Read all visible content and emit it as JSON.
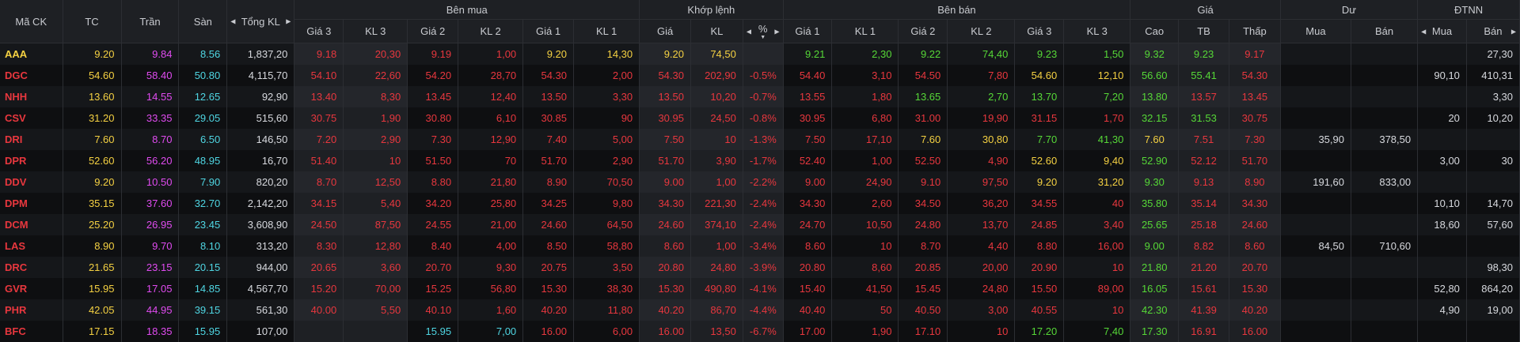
{
  "headers": {
    "symbol": "Mã CK",
    "ref": "TC",
    "ceiling": "Trần",
    "floor": "Sàn",
    "total_vol": "Tổng KL",
    "groups": {
      "buy": "Bên mua",
      "match": "Khớp lệnh",
      "sell": "Bên bán",
      "price": "Giá",
      "residual": "Dư",
      "foreign": "ĐTNN"
    },
    "buy": [
      "Giá 3",
      "KL 3",
      "Giá 2",
      "KL 2",
      "Giá 1",
      "KL 1"
    ],
    "match": [
      "Giá",
      "KL",
      "%"
    ],
    "sell": [
      "Giá 1",
      "KL 1",
      "Giá 2",
      "KL 2",
      "Giá 3",
      "KL 3"
    ],
    "price": [
      "Cao",
      "TB",
      "Thấp"
    ],
    "residual": [
      "Mua",
      "Bán"
    ],
    "foreign": [
      "Mua",
      "Bán"
    ]
  },
  "colors": {
    "ref": "#f5d142",
    "ceiling": "#e04bf0",
    "floor": "#4fd6e3",
    "up": "#56d837",
    "down": "#e8373e",
    "header_bg": "#1e2024"
  },
  "icons": {
    "sort_left": "caret-left-icon",
    "sort_right": "caret-right-icon",
    "sort_down": "sort-down-icon"
  },
  "rows": [
    {
      "sym": "AAA",
      "tc": "9.20",
      "tran": "9.84",
      "san": "8.56",
      "tkl": "1,837,20",
      "b3p": "9.18",
      "b3v": "20,30",
      "b2p": "9.19",
      "b2v": "1,00",
      "b1p": "9.20",
      "b1v": "14,30",
      "mp": "9.20",
      "mv": "74,50",
      "pct": "",
      "s1p": "9.21",
      "s1v": "2,30",
      "s2p": "9.22",
      "s2v": "74,40",
      "s3p": "9.23",
      "s3v": "1,50",
      "hi": "9.32",
      "avg": "9.23",
      "lo": "9.17",
      "dm": "",
      "db": "",
      "fm": "",
      "fb": "27,30",
      "symc": "eq",
      "b3c": "dn",
      "b2c": "dn",
      "b1c": "eq",
      "mc": "eq",
      "s1c": "up",
      "s2c": "up",
      "s3c": "up",
      "hic": "up",
      "avgc": "up",
      "loc": "dn"
    },
    {
      "sym": "DGC",
      "tc": "54.60",
      "tran": "58.40",
      "san": "50.80",
      "tkl": "4,115,70",
      "b3p": "54.10",
      "b3v": "22,60",
      "b2p": "54.20",
      "b2v": "28,70",
      "b1p": "54.30",
      "b1v": "2,00",
      "mp": "54.30",
      "mv": "202,90",
      "pct": "-0.5%",
      "s1p": "54.40",
      "s1v": "3,10",
      "s2p": "54.50",
      "s2v": "7,80",
      "s3p": "54.60",
      "s3v": "12,10",
      "hi": "56.60",
      "avg": "55.41",
      "lo": "54.30",
      "dm": "",
      "db": "",
      "fm": "90,10",
      "fb": "410,31",
      "symc": "dn",
      "b3c": "dn",
      "b2c": "dn",
      "b1c": "dn",
      "mc": "dn",
      "s1c": "dn",
      "s2c": "dn",
      "s3c": "eq",
      "hic": "up",
      "avgc": "up",
      "loc": "dn"
    },
    {
      "sym": "NHH",
      "tc": "13.60",
      "tran": "14.55",
      "san": "12.65",
      "tkl": "92,90",
      "b3p": "13.40",
      "b3v": "8,30",
      "b2p": "13.45",
      "b2v": "12,40",
      "b1p": "13.50",
      "b1v": "3,30",
      "mp": "13.50",
      "mv": "10,20",
      "pct": "-0.7%",
      "s1p": "13.55",
      "s1v": "1,80",
      "s2p": "13.65",
      "s2v": "2,70",
      "s3p": "13.70",
      "s3v": "7,20",
      "hi": "13.80",
      "avg": "13.57",
      "lo": "13.45",
      "dm": "",
      "db": "",
      "fm": "",
      "fb": "3,30",
      "symc": "dn",
      "b3c": "dn",
      "b2c": "dn",
      "b1c": "dn",
      "mc": "dn",
      "s1c": "dn",
      "s2c": "up",
      "s3c": "up",
      "hic": "up",
      "avgc": "dn",
      "loc": "dn"
    },
    {
      "sym": "CSV",
      "tc": "31.20",
      "tran": "33.35",
      "san": "29.05",
      "tkl": "515,60",
      "b3p": "30.75",
      "b3v": "1,90",
      "b2p": "30.80",
      "b2v": "6,10",
      "b1p": "30.85",
      "b1v": "90",
      "mp": "30.95",
      "mv": "24,50",
      "pct": "-0.8%",
      "s1p": "30.95",
      "s1v": "6,80",
      "s2p": "31.00",
      "s2v": "19,90",
      "s3p": "31.15",
      "s3v": "1,70",
      "hi": "32.15",
      "avg": "31.53",
      "lo": "30.75",
      "dm": "",
      "db": "",
      "fm": "20",
      "fb": "10,20",
      "symc": "dn",
      "b3c": "dn",
      "b2c": "dn",
      "b1c": "dn",
      "mc": "dn",
      "s1c": "dn",
      "s2c": "dn",
      "s3c": "dn",
      "hic": "up",
      "avgc": "up",
      "loc": "dn"
    },
    {
      "sym": "DRI",
      "tc": "7.60",
      "tran": "8.70",
      "san": "6.50",
      "tkl": "146,50",
      "b3p": "7.20",
      "b3v": "2,90",
      "b2p": "7.30",
      "b2v": "12,90",
      "b1p": "7.40",
      "b1v": "5,00",
      "mp": "7.50",
      "mv": "10",
      "pct": "-1.3%",
      "s1p": "7.50",
      "s1v": "17,10",
      "s2p": "7.60",
      "s2v": "30,80",
      "s3p": "7.70",
      "s3v": "41,30",
      "hi": "7.60",
      "avg": "7.51",
      "lo": "7.30",
      "dm": "35,90",
      "db": "378,50",
      "fm": "",
      "fb": "",
      "symc": "dn",
      "b3c": "dn",
      "b2c": "dn",
      "b1c": "dn",
      "mc": "dn",
      "s1c": "dn",
      "s2c": "eq",
      "s3c": "up",
      "hic": "eq",
      "avgc": "dn",
      "loc": "dn"
    },
    {
      "sym": "DPR",
      "tc": "52.60",
      "tran": "56.20",
      "san": "48.95",
      "tkl": "16,70",
      "b3p": "51.40",
      "b3v": "10",
      "b2p": "51.50",
      "b2v": "70",
      "b1p": "51.70",
      "b1v": "2,90",
      "mp": "51.70",
      "mv": "3,90",
      "pct": "-1.7%",
      "s1p": "52.40",
      "s1v": "1,00",
      "s2p": "52.50",
      "s2v": "4,90",
      "s3p": "52.60",
      "s3v": "9,40",
      "hi": "52.90",
      "avg": "52.12",
      "lo": "51.70",
      "dm": "",
      "db": "",
      "fm": "3,00",
      "fb": "30",
      "symc": "dn",
      "b3c": "dn",
      "b2c": "dn",
      "b1c": "dn",
      "mc": "dn",
      "s1c": "dn",
      "s2c": "dn",
      "s3c": "eq",
      "hic": "up",
      "avgc": "dn",
      "loc": "dn"
    },
    {
      "sym": "DDV",
      "tc": "9.20",
      "tran": "10.50",
      "san": "7.90",
      "tkl": "820,20",
      "b3p": "8.70",
      "b3v": "12,50",
      "b2p": "8.80",
      "b2v": "21,80",
      "b1p": "8.90",
      "b1v": "70,50",
      "mp": "9.00",
      "mv": "1,00",
      "pct": "-2.2%",
      "s1p": "9.00",
      "s1v": "24,90",
      "s2p": "9.10",
      "s2v": "97,50",
      "s3p": "9.20",
      "s3v": "31,20",
      "hi": "9.30",
      "avg": "9.13",
      "lo": "8.90",
      "dm": "191,60",
      "db": "833,00",
      "fm": "",
      "fb": "",
      "symc": "dn",
      "b3c": "dn",
      "b2c": "dn",
      "b1c": "dn",
      "mc": "dn",
      "s1c": "dn",
      "s2c": "dn",
      "s3c": "eq",
      "hic": "up",
      "avgc": "dn",
      "loc": "dn"
    },
    {
      "sym": "DPM",
      "tc": "35.15",
      "tran": "37.60",
      "san": "32.70",
      "tkl": "2,142,20",
      "b3p": "34.15",
      "b3v": "5,40",
      "b2p": "34.20",
      "b2v": "25,80",
      "b1p": "34.25",
      "b1v": "9,80",
      "mp": "34.30",
      "mv": "221,30",
      "pct": "-2.4%",
      "s1p": "34.30",
      "s1v": "2,60",
      "s2p": "34.50",
      "s2v": "36,20",
      "s3p": "34.55",
      "s3v": "40",
      "hi": "35.80",
      "avg": "35.14",
      "lo": "34.30",
      "dm": "",
      "db": "",
      "fm": "10,10",
      "fb": "14,70",
      "symc": "dn",
      "b3c": "dn",
      "b2c": "dn",
      "b1c": "dn",
      "mc": "dn",
      "s1c": "dn",
      "s2c": "dn",
      "s3c": "dn",
      "hic": "up",
      "avgc": "dn",
      "loc": "dn"
    },
    {
      "sym": "DCM",
      "tc": "25.20",
      "tran": "26.95",
      "san": "23.45",
      "tkl": "3,608,90",
      "b3p": "24.50",
      "b3v": "87,50",
      "b2p": "24.55",
      "b2v": "21,00",
      "b1p": "24.60",
      "b1v": "64,50",
      "mp": "24.60",
      "mv": "374,10",
      "pct": "-2.4%",
      "s1p": "24.70",
      "s1v": "10,50",
      "s2p": "24.80",
      "s2v": "13,70",
      "s3p": "24.85",
      "s3v": "3,40",
      "hi": "25.65",
      "avg": "25.18",
      "lo": "24.60",
      "dm": "",
      "db": "",
      "fm": "18,60",
      "fb": "57,60",
      "symc": "dn",
      "b3c": "dn",
      "b2c": "dn",
      "b1c": "dn",
      "mc": "dn",
      "s1c": "dn",
      "s2c": "dn",
      "s3c": "dn",
      "hic": "up",
      "avgc": "dn",
      "loc": "dn"
    },
    {
      "sym": "LAS",
      "tc": "8.90",
      "tran": "9.70",
      "san": "8.10",
      "tkl": "313,20",
      "b3p": "8.30",
      "b3v": "12,80",
      "b2p": "8.40",
      "b2v": "4,00",
      "b1p": "8.50",
      "b1v": "58,80",
      "mp": "8.60",
      "mv": "1,00",
      "pct": "-3.4%",
      "s1p": "8.60",
      "s1v": "10",
      "s2p": "8.70",
      "s2v": "4,40",
      "s3p": "8.80",
      "s3v": "16,00",
      "hi": "9.00",
      "avg": "8.82",
      "lo": "8.60",
      "dm": "84,50",
      "db": "710,60",
      "fm": "",
      "fb": "",
      "symc": "dn",
      "b3c": "dn",
      "b2c": "dn",
      "b1c": "dn",
      "mc": "dn",
      "s1c": "dn",
      "s2c": "dn",
      "s3c": "dn",
      "hic": "up",
      "avgc": "dn",
      "loc": "dn"
    },
    {
      "sym": "DRC",
      "tc": "21.65",
      "tran": "23.15",
      "san": "20.15",
      "tkl": "944,00",
      "b3p": "20.65",
      "b3v": "3,60",
      "b2p": "20.70",
      "b2v": "9,30",
      "b1p": "20.75",
      "b1v": "3,50",
      "mp": "20.80",
      "mv": "24,80",
      "pct": "-3.9%",
      "s1p": "20.80",
      "s1v": "8,60",
      "s2p": "20.85",
      "s2v": "20,00",
      "s3p": "20.90",
      "s3v": "10",
      "hi": "21.80",
      "avg": "21.20",
      "lo": "20.70",
      "dm": "",
      "db": "",
      "fm": "",
      "fb": "98,30",
      "symc": "dn",
      "b3c": "dn",
      "b2c": "dn",
      "b1c": "dn",
      "mc": "dn",
      "s1c": "dn",
      "s2c": "dn",
      "s3c": "dn",
      "hic": "up",
      "avgc": "dn",
      "loc": "dn"
    },
    {
      "sym": "GVR",
      "tc": "15.95",
      "tran": "17.05",
      "san": "14.85",
      "tkl": "4,567,70",
      "b3p": "15.20",
      "b3v": "70,00",
      "b2p": "15.25",
      "b2v": "56,80",
      "b1p": "15.30",
      "b1v": "38,30",
      "mp": "15.30",
      "mv": "490,80",
      "pct": "-4.1%",
      "s1p": "15.40",
      "s1v": "41,50",
      "s2p": "15.45",
      "s2v": "24,80",
      "s3p": "15.50",
      "s3v": "89,00",
      "hi": "16.05",
      "avg": "15.61",
      "lo": "15.30",
      "dm": "",
      "db": "",
      "fm": "52,80",
      "fb": "864,20",
      "symc": "dn",
      "b3c": "dn",
      "b2c": "dn",
      "b1c": "dn",
      "mc": "dn",
      "s1c": "dn",
      "s2c": "dn",
      "s3c": "dn",
      "hic": "up",
      "avgc": "dn",
      "loc": "dn"
    },
    {
      "sym": "PHR",
      "tc": "42.05",
      "tran": "44.95",
      "san": "39.15",
      "tkl": "561,30",
      "b3p": "40.00",
      "b3v": "5,50",
      "b2p": "40.10",
      "b2v": "1,60",
      "b1p": "40.20",
      "b1v": "11,80",
      "mp": "40.20",
      "mv": "86,70",
      "pct": "-4.4%",
      "s1p": "40.40",
      "s1v": "50",
      "s2p": "40.50",
      "s2v": "3,00",
      "s3p": "40.55",
      "s3v": "10",
      "hi": "42.30",
      "avg": "41.39",
      "lo": "40.20",
      "dm": "",
      "db": "",
      "fm": "4,90",
      "fb": "19,00",
      "symc": "dn",
      "b3c": "dn",
      "b2c": "dn",
      "b1c": "dn",
      "mc": "dn",
      "s1c": "dn",
      "s2c": "dn",
      "s3c": "dn",
      "hic": "up",
      "avgc": "dn",
      "loc": "dn"
    },
    {
      "sym": "BFC",
      "tc": "17.15",
      "tran": "18.35",
      "san": "15.95",
      "tkl": "107,00",
      "b3p": "",
      "b3v": "",
      "b2p": "15.95",
      "b2v": "7,00",
      "b1p": "16.00",
      "b1v": "6,00",
      "mp": "16.00",
      "mv": "13,50",
      "pct": "-6.7%",
      "s1p": "17.00",
      "s1v": "1,90",
      "s2p": "17.10",
      "s2v": "10",
      "s3p": "17.20",
      "s3v": "7,40",
      "hi": "17.30",
      "avg": "16.91",
      "lo": "16.00",
      "dm": "",
      "db": "",
      "fm": "",
      "fb": "",
      "symc": "dn",
      "b3c": "dn",
      "b2c": "floor",
      "b1c": "dn",
      "mc": "dn",
      "s1c": "dn",
      "s2c": "dn",
      "s3c": "up",
      "hic": "up",
      "avgc": "dn",
      "loc": "dn"
    }
  ]
}
